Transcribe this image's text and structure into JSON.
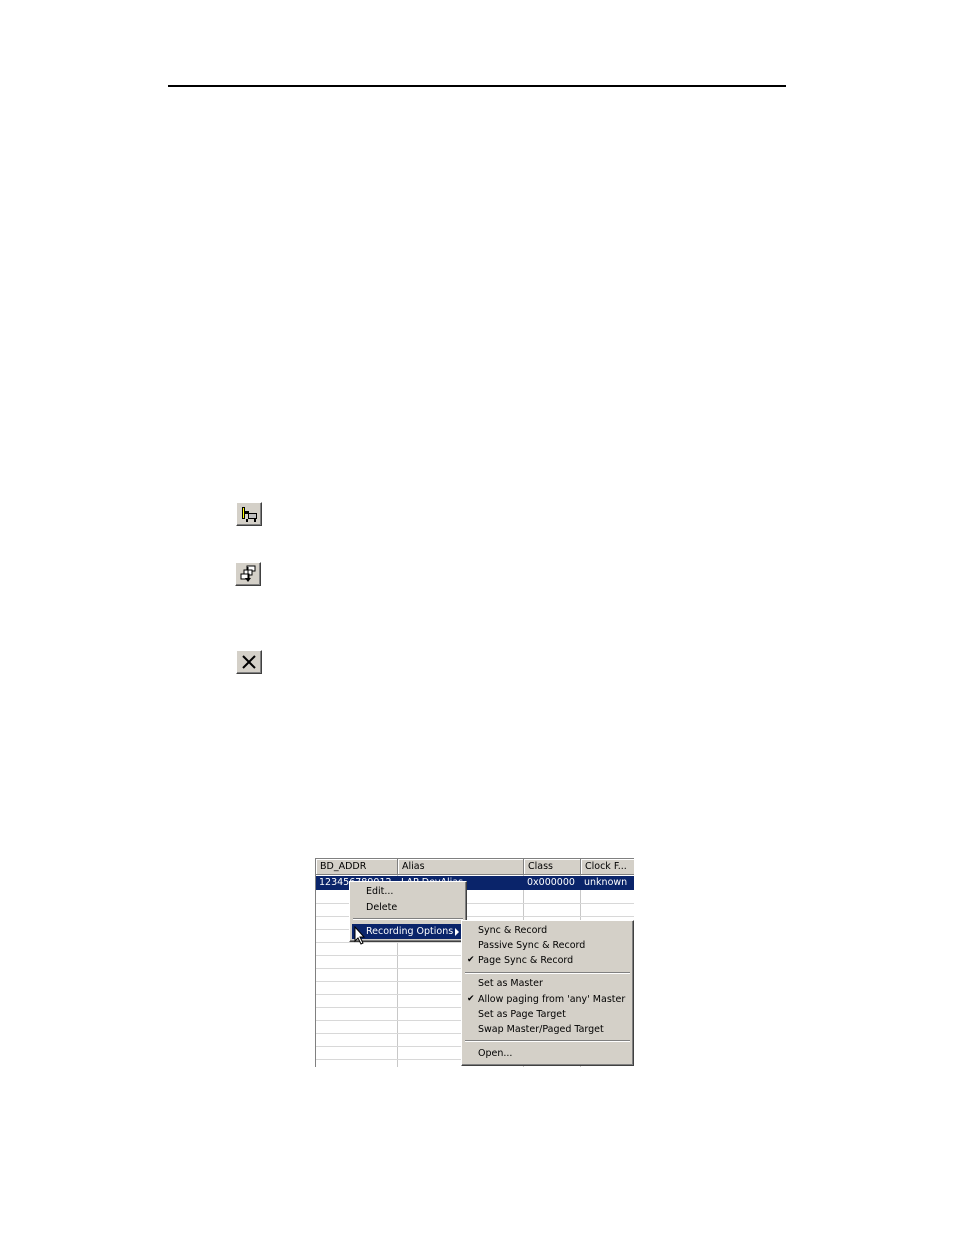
{
  "toolbar_icons": [
    {
      "name": "connect-icon"
    },
    {
      "name": "stack-icon"
    },
    {
      "name": "close-icon"
    }
  ],
  "device_list": {
    "columns": [
      "BD_ADDR",
      "Alias",
      "Class",
      "Clock F..."
    ],
    "selected_row": {
      "bd_addr": "123456789012",
      "alias": "LAP DevAlias",
      "class": "0x000000",
      "clock": "unknown"
    }
  },
  "context_menu": {
    "items": [
      "Edit...",
      "Delete"
    ],
    "submenu_trigger": "Recording Options"
  },
  "submenu": {
    "group1": [
      {
        "label": "Sync & Record",
        "checked": false
      },
      {
        "label": "Passive Sync & Record",
        "checked": false
      },
      {
        "label": "Page Sync & Record",
        "checked": true
      }
    ],
    "group2": [
      {
        "label": "Set as Master",
        "checked": false
      },
      {
        "label": "Allow paging from 'any' Master",
        "checked": true
      },
      {
        "label": "Set as Page Target",
        "checked": false
      },
      {
        "label": "Swap Master/Paged Target",
        "checked": false
      }
    ],
    "group3": [
      {
        "label": "Open...",
        "checked": false
      }
    ],
    "check_glyph": "✔"
  }
}
